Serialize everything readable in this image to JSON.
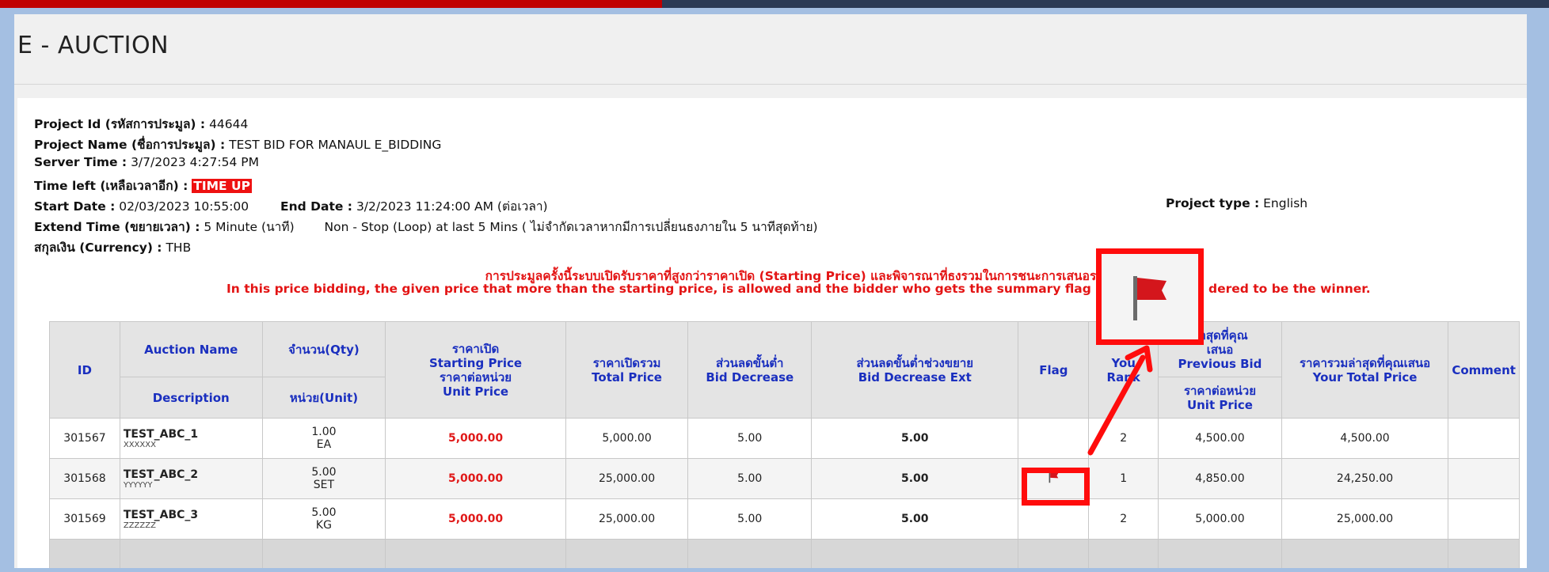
{
  "page": {
    "title": "E - AUCTION"
  },
  "project": {
    "id_label": "Project Id (รหัสการประมูล) :",
    "id_value": "44644",
    "name_label": "Project Name (ชื่อการประมูล) :",
    "name_value": "TEST BID FOR MANAUL E_BIDDING",
    "server_time_label": "Server Time :",
    "server_time_value": "3/7/2023 4:27:54 PM",
    "time_left_label": "Time left (เหลือเวลาอีก) :",
    "time_left_value": "TIME UP",
    "start_date_label": "Start Date :",
    "start_date_value": "02/03/2023 10:55:00",
    "end_date_label": "End Date :",
    "end_date_value": "3/2/2023 11:24:00 AM (ต่อเวลา)",
    "project_type_label": "Project type :",
    "project_type_value": "English",
    "extend_label": "Extend Time (ขยายเวลา) :",
    "extend_value": "5  Minute (นาที)",
    "extend_note": "Non - Stop (Loop) at last 5 Mins ( ไม่จำกัดเวลาหากมีการเปลี่ยนธงภายใน 5 นาทีสุดท้าย)",
    "currency_label": "สกุลเงิน (Currency) :",
    "currency_value": "THB"
  },
  "notice": {
    "thai": "การประมูลครั้งนี้ระบบเปิดรับราคาที่สูงกว่าราคาเปิด (Starting Price) และพิจารณาที่ธงรวมในการชนะการเสนอราคาเ",
    "english": "In this price bidding, the given price that more than the starting price, is allowed and the bidder who gets the summary flag (not item flag) i",
    "english_tail": "dered to be the winner."
  },
  "table": {
    "headers": {
      "id": "ID",
      "auction_name": "Auction Name",
      "description": "Description",
      "qty": "จำนวน(Qty)",
      "unit": "หน่วย(Unit)",
      "start_price_th": "ราคาเปิด",
      "start_price_en": "Starting Price",
      "unit_price_th": "ราคาต่อหน่วย",
      "unit_price_en": "Unit Price",
      "total_price_th": "ราคาเปิดรวม",
      "total_price_en": "Total Price",
      "bid_dec_th": "ส่วนลดขั้นต่ำ",
      "bid_dec_en": "Bid Decrease",
      "bid_dec_ext_th": "ส่วนลดขั้นต่ำช่วงขยาย",
      "bid_dec_ext_en": "Bid Decrease Ext",
      "flag": "Flag",
      "rank_1": "You",
      "rank_2": "Rank",
      "prev_bid_th": "ล่าสุดที่คุณ",
      "prev_bid_th2": "เสนอ",
      "prev_bid_en": "Previous Bid",
      "prev_unit_th": "ราคาต่อหน่วย",
      "prev_unit_en": "Unit Price",
      "your_total_th": "ราคารวมล่าสุดที่คุณเสนอ",
      "your_total_en": "Your Total Price",
      "comment": "Comment"
    },
    "rows": [
      {
        "id": "301567",
        "name": "TEST_ABC_1",
        "desc": "XXXXXX",
        "qty": "1.00",
        "unit": "EA",
        "start_price": "5,000.00",
        "total_price": "5,000.00",
        "bid_dec": "5.00",
        "bid_dec_ext": "5.00",
        "rank": "2",
        "prev_bid": "4,500.00",
        "your_total": "4,500.00"
      },
      {
        "id": "301568",
        "name": "TEST_ABC_2",
        "desc": "YYYYYY",
        "qty": "5.00",
        "unit": "SET",
        "start_price": "5,000.00",
        "total_price": "25,000.00",
        "bid_dec": "5.00",
        "bid_dec_ext": "5.00",
        "rank": "1",
        "prev_bid": "4,850.00",
        "your_total": "24,250.00"
      },
      {
        "id": "301569",
        "name": "TEST_ABC_3",
        "desc": "ZZZZZZ",
        "qty": "5.00",
        "unit": "KG",
        "start_price": "5,000.00",
        "total_price": "25,000.00",
        "bid_dec": "5.00",
        "bid_dec_ext": "5.00",
        "rank": "2",
        "prev_bid": "5,000.00",
        "your_total": "25,000.00"
      }
    ]
  },
  "annotation": {
    "icon": "flag-icon",
    "color": "#ff0c0c",
    "flag_color": "#d4161c"
  }
}
